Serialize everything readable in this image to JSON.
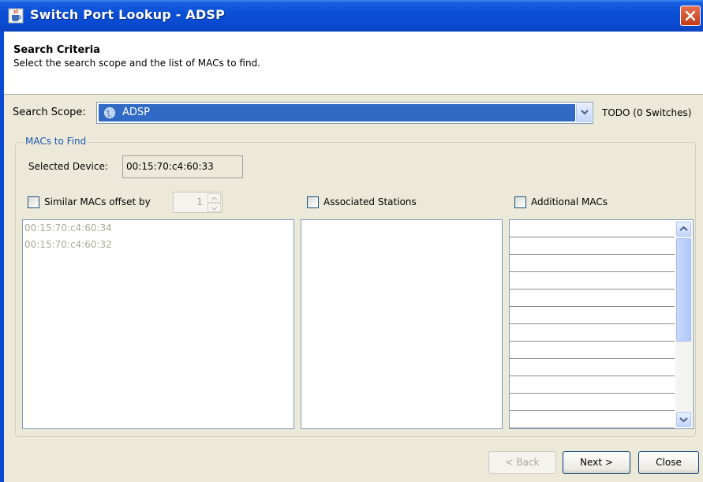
{
  "window": {
    "title": "Switch Port Lookup - ADSP"
  },
  "header": {
    "title": "Search Criteria",
    "subtitle": "Select the search scope and the list of MACs to find."
  },
  "search_scope": {
    "label": "Search Scope:",
    "selected": "ADSP",
    "count_text": "TODO (0 Switches)"
  },
  "macs_group": {
    "legend": "MACs to Find",
    "selected_device_label": "Selected Device:",
    "selected_device_value": "00:15:70:c4:60:33",
    "similar_label": "Similar MACs offset by",
    "offset_value": "1",
    "similar_macs": [
      "00:15:70:c4:60:34",
      "00:15:70:c4:60:32"
    ],
    "associated_label": "Associated Stations",
    "additional_label": "Additional MACs"
  },
  "buttons": {
    "back": "< Back",
    "next": "Next >",
    "close": "Close"
  },
  "colors": {
    "titlebar": "#0b4fd6",
    "selection": "#316ac5",
    "legend": "#1d5aac",
    "background": "#ece9d8"
  },
  "icons": {
    "app": "java-cup-icon",
    "close": "close-icon",
    "scope": "globe-icon"
  }
}
